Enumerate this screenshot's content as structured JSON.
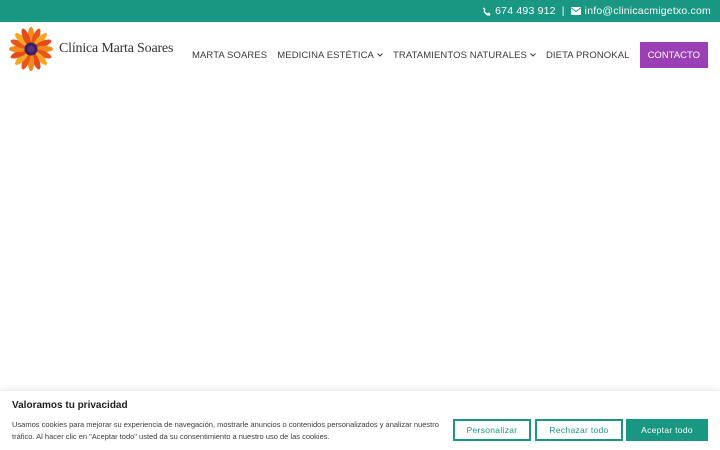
{
  "topbar": {
    "phone_icon": "phone-icon",
    "phone": "674 493 912",
    "separator": "|",
    "email_icon": "envelope-icon",
    "email": "info@clinicacmigetxo.com",
    "bg_color": "#1a9782"
  },
  "header": {
    "logo_text": "Clínica Marta Soares",
    "logo_icon": "flower-icon"
  },
  "nav": {
    "items": [
      {
        "label": "MARTA SOARES",
        "has_dropdown": false
      },
      {
        "label": "MEDICINA ESTÉTICA",
        "has_dropdown": true
      },
      {
        "label": "TRATAMIENTOS NATURALES",
        "has_dropdown": true
      },
      {
        "label": "DIETA PRONOKAL",
        "has_dropdown": false
      }
    ],
    "contact_label": "CONTACTO",
    "contact_color": "#9b3fb5"
  },
  "cookie": {
    "title": "Valoramos tu privacidad",
    "text": "Usamos cookies para mejorar su experiencia de navegación, mostrarle anuncios o contenidos personalizados y analizar nuestro tráfico. Al hacer clic en \"Aceptar todo\" usted da su consentimiento a nuestro uso de las cookies.",
    "customize_label": "Personalizar",
    "reject_label": "Rechazar todo",
    "accept_label": "Aceptar todo",
    "accent_color": "#1a9782"
  }
}
